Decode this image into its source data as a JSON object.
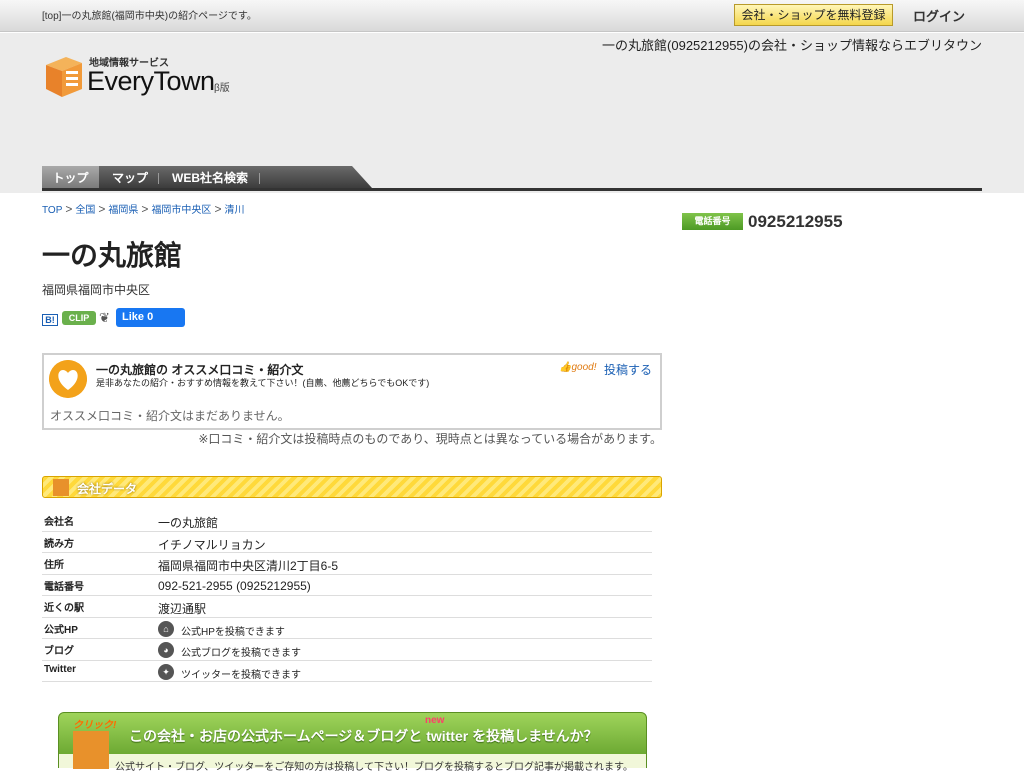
{
  "topbar": {
    "description": "[top]一の丸旅館(福岡市中央)の紹介ページです。",
    "register_label": "会社・ショップを無料登録",
    "login_label": "ログイン"
  },
  "header": {
    "tagline": "一の丸旅館(0925212955)の会社・ショップ情報ならエブリタウン",
    "logo_sub": "地域情報サービス",
    "logo_main": "EveryTown",
    "logo_beta": "β版"
  },
  "nav": {
    "items": [
      {
        "label": "トップ"
      },
      {
        "label": "マップ"
      },
      {
        "label": "WEB社名検索"
      }
    ]
  },
  "breadcrumb": [
    "TOP",
    "全国",
    "福岡県",
    "福岡市中央区",
    "清川"
  ],
  "page": {
    "title": "一の丸旅館",
    "address_short": "福岡県福岡市中央区"
  },
  "social": {
    "hatena": "B!",
    "clip": "CLIP",
    "fb_like": "Like 0"
  },
  "review": {
    "title": "一の丸旅館の オススメ口コミ・紹介文",
    "subtitle": "是非あなたの紹介・おすすめ情報を教えて下さい！(自薦、他薦どちらでもOKです)",
    "good": "good!",
    "post_label": "投稿する",
    "empty_text": "オススメ口コミ・紹介文はまだありません。",
    "note": "※口コミ・紹介文は投稿時点のものであり、現時点とは異なっている場合があります。"
  },
  "company": {
    "section_title": "会社データ",
    "rows": [
      {
        "label": "会社名",
        "value": "一の丸旅館"
      },
      {
        "label": "読み方",
        "value": "イチノマルリョカン"
      },
      {
        "label": "住所",
        "value": "福岡県福岡市中央区清川2丁目6-5"
      },
      {
        "label": "電話番号",
        "value": "092-521-2955 (0925212955)"
      },
      {
        "label": "近くの駅",
        "value": "渡辺通駅"
      },
      {
        "label": "公式HP",
        "value": "公式HPを投稿できます"
      },
      {
        "label": "ブログ",
        "value": "公式ブログを投稿できます"
      },
      {
        "label": "Twitter",
        "value": "ツイッターを投稿できます"
      }
    ]
  },
  "phone": {
    "badge": "電話番号",
    "number": "0925212955"
  },
  "banner": {
    "click": "クリック!",
    "new": "new",
    "text": "この会社・お店の公式ホームページ＆ブログと twitter を投稿しませんか？",
    "sub": "公式サイト・ブログ、ツイッターをご存知の方は投稿して下さい！ブログを投稿するとブログ記事が掲載されます。"
  }
}
